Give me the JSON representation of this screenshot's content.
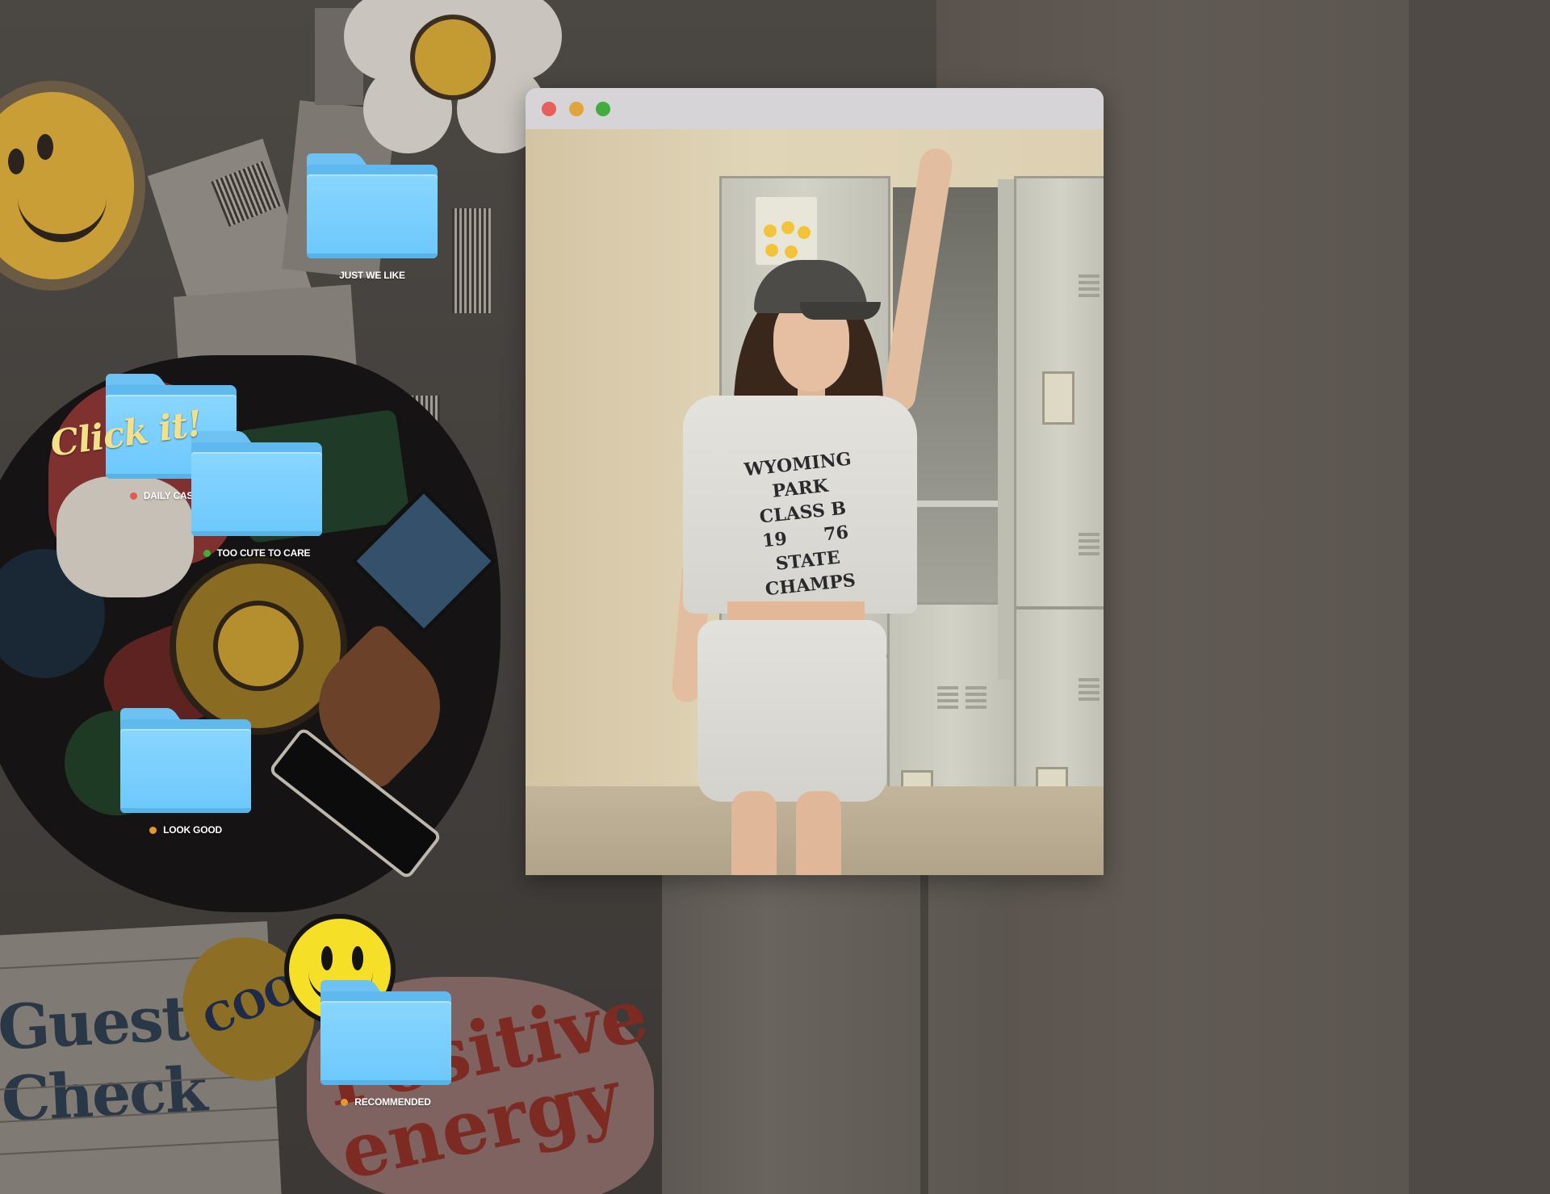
{
  "desktop": {
    "callout": "Click it!",
    "folders": [
      {
        "name": "JUST WE LIKE",
        "dot_color": null
      },
      {
        "name": "DAILY CASUAL",
        "dot_color": "#e05a55"
      },
      {
        "name": "TOO CUTE TO CARE",
        "dot_color": "#3fae3c"
      },
      {
        "name": "LOOK GOOD",
        "dot_color": "#e39a2d"
      },
      {
        "name": "RECOMMENDED",
        "dot_color": "#e39a2d"
      }
    ]
  },
  "window": {
    "traffic_lights": {
      "close": "#e65f5a",
      "minimize": "#e1a43a",
      "maximize": "#3fae3c"
    },
    "photo": {
      "shirt_print": [
        "WYOMING PARK",
        "CLASS B",
        "19      76",
        "STATE CHAMPS"
      ]
    }
  },
  "background": {
    "stickers": [
      "Guest Check",
      "COOL",
      "Positive energy"
    ]
  }
}
